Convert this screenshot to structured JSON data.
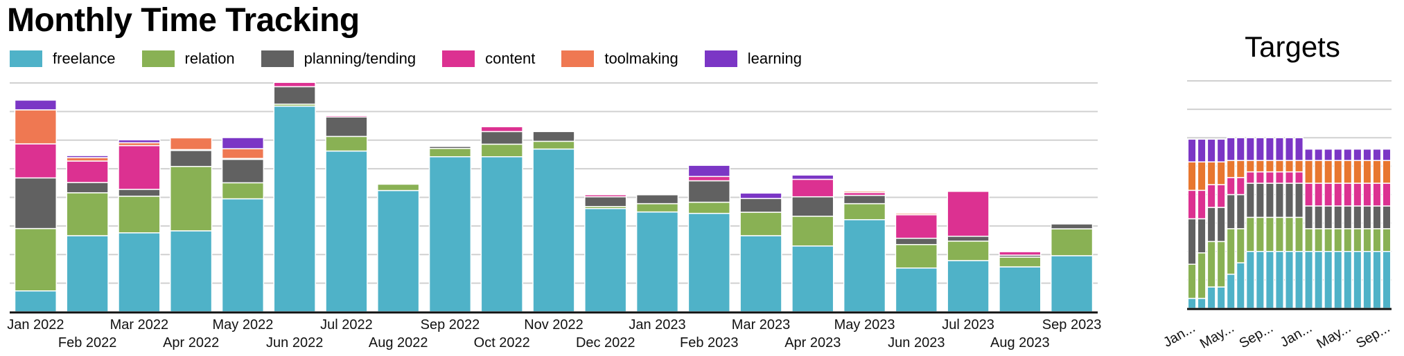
{
  "title": "Monthly Time Tracking",
  "targets_title": "Targets",
  "legend": [
    {
      "name": "freelance",
      "color": "#4fb2c8"
    },
    {
      "name": "relation",
      "color": "#89b154"
    },
    {
      "name": "planning/tending",
      "color": "#616161"
    },
    {
      "name": "content",
      "color": "#dc3191"
    },
    {
      "name": "toolmaking",
      "color": "#ef7852"
    },
    {
      "name": "learning",
      "color": "#7b36c5"
    }
  ],
  "chart_data": [
    {
      "type": "bar",
      "stacked": true,
      "title": "Monthly Time Tracking",
      "xlabel": "",
      "ylabel": "",
      "ylim": [
        0,
        80
      ],
      "grid": true,
      "legend_position": "top-left",
      "categories": [
        "Jan 2022",
        "Feb 2022",
        "Mar 2022",
        "Apr 2022",
        "May 2022",
        "Jun 2022",
        "Jul 2022",
        "Aug 2022",
        "Sep 2022",
        "Oct 2022",
        "Nov 2022",
        "Dec 2022",
        "Jan 2023",
        "Feb 2023",
        "Mar 2023",
        "Apr 2023",
        "May 2023",
        "Jun 2023",
        "Jul 2023",
        "Aug 2023",
        "Sep 2023"
      ],
      "series": [
        {
          "name": "freelance",
          "color": "#4fb2c8",
          "values": [
            7.3,
            26.6,
            27.6,
            28.3,
            39.5,
            71.9,
            56.2,
            42.4,
            54.2,
            54.2,
            56.9,
            36.1,
            34.9,
            34.4,
            26.6,
            23.0,
            32.2,
            15.3,
            17.9,
            15.7,
            19.6
          ]
        },
        {
          "name": "relation",
          "color": "#89b154",
          "values": [
            21.8,
            15.0,
            12.8,
            22.5,
            5.6,
            0.7,
            5.1,
            2.2,
            2.9,
            4.4,
            2.7,
            0.7,
            2.9,
            3.9,
            8.2,
            10.4,
            5.6,
            8.2,
            6.8,
            3.4,
            9.4
          ]
        },
        {
          "name": "planning/tending",
          "color": "#616161",
          "values": [
            17.7,
            3.6,
            2.4,
            5.6,
            8.2,
            6.1,
            6.8,
            0,
            0.7,
            4.4,
            3.4,
            3.4,
            3.1,
            7.5,
            4.8,
            6.8,
            2.9,
            2.2,
            1.7,
            0.7,
            1.7
          ]
        },
        {
          "name": "content",
          "color": "#dc3191",
          "values": [
            11.9,
            7.5,
            15.3,
            0.3,
            0.3,
            1.5,
            0.5,
            0,
            0,
            1.7,
            0,
            0.7,
            0,
            1.5,
            0,
            6.1,
            1.0,
            8.2,
            15.7,
            1.2,
            0
          ]
        },
        {
          "name": "toolmaking",
          "color": "#ef7852",
          "values": [
            11.9,
            1.2,
            1.0,
            4.1,
            3.4,
            0,
            0,
            0,
            0,
            0,
            0,
            0,
            0,
            0,
            0,
            0,
            0.5,
            0.5,
            0,
            0,
            0
          ]
        },
        {
          "name": "learning",
          "color": "#7b36c5",
          "values": [
            3.4,
            0.7,
            1.0,
            0,
            3.9,
            0,
            0.3,
            0,
            0,
            0,
            0,
            0,
            0,
            3.9,
            1.9,
            1.5,
            0,
            0,
            0,
            0,
            0
          ]
        }
      ]
    },
    {
      "type": "bar",
      "stacked": true,
      "title": "Targets",
      "xlabel": "",
      "ylabel": "",
      "ylim": [
        0,
        80
      ],
      "grid": true,
      "categories": [
        "Jan 2022",
        "Feb 2022",
        "Mar 2022",
        "Apr 2022",
        "May 2022",
        "Jun 2022",
        "Jul 2022",
        "Aug 2022",
        "Sep 2022",
        "Oct 2022",
        "Nov 2022",
        "Dec 2022",
        "Jan 2023",
        "Feb 2023",
        "Mar 2023",
        "Apr 2023",
        "May 2023",
        "Jun 2023",
        "Jul 2023",
        "Aug 2023",
        "Sep 2023"
      ],
      "tick_labels": [
        "Jan...",
        "May...",
        "Sep...",
        "Jan...",
        "May...",
        "Sep..."
      ],
      "tick_indices": [
        0,
        4,
        8,
        12,
        16,
        20
      ],
      "series": [
        {
          "name": "freelance",
          "color": "#4fb2c8",
          "values": [
            3.5,
            3.5,
            7.5,
            7.5,
            12,
            16,
            20,
            20,
            20,
            20,
            20,
            20,
            20,
            20,
            20,
            20,
            20,
            20,
            20,
            20,
            20
          ]
        },
        {
          "name": "relation",
          "color": "#89b154",
          "values": [
            12,
            16,
            16,
            16,
            16,
            12,
            12,
            12,
            12,
            12,
            12,
            12,
            8,
            8,
            8,
            8,
            8,
            8,
            8,
            8,
            8
          ]
        },
        {
          "name": "planning/tending",
          "color": "#616161",
          "values": [
            16,
            12,
            12,
            12,
            12,
            12,
            12,
            12,
            12,
            12,
            12,
            12,
            8,
            8,
            8,
            8,
            8,
            8,
            8,
            8,
            8
          ]
        },
        {
          "name": "content",
          "color": "#dc3191",
          "values": [
            10,
            10,
            8,
            8,
            6,
            6,
            4,
            4,
            4,
            4,
            4,
            4,
            8,
            8,
            8,
            8,
            8,
            8,
            8,
            8,
            8
          ]
        },
        {
          "name": "toolmaking",
          "color": "#e8772f",
          "values": [
            10,
            10,
            8,
            8,
            6,
            6,
            4,
            4,
            4,
            4,
            4,
            4,
            8,
            8,
            8,
            8,
            8,
            8,
            8,
            8,
            8
          ]
        },
        {
          "name": "learning",
          "color": "#7b36c5",
          "values": [
            8,
            8,
            8,
            8,
            8,
            8,
            8,
            8,
            8,
            8,
            8,
            8,
            4,
            4,
            4,
            4,
            4,
            4,
            4,
            4,
            4
          ]
        }
      ]
    }
  ]
}
